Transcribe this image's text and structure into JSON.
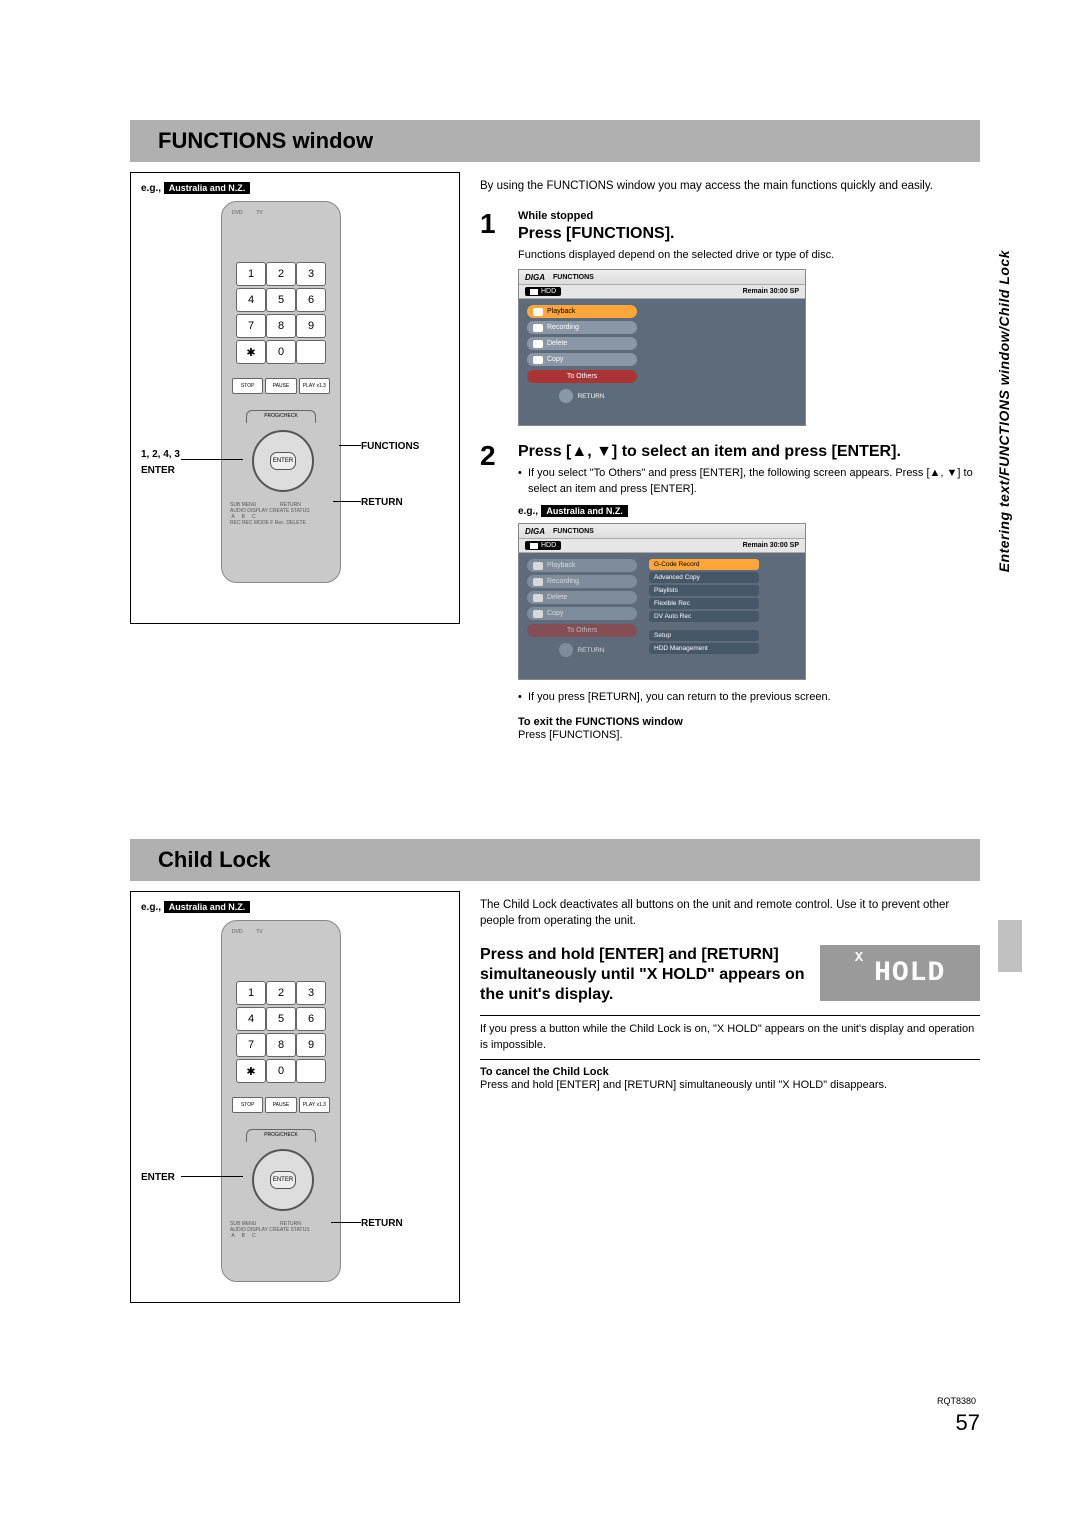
{
  "side_header": "Entering text/FUNCTIONS window/Child Lock",
  "doc_code": "RQT8380",
  "page_number": "57",
  "section1": {
    "title": "FUNCTIONS window",
    "illus": {
      "eg": "e.g.,",
      "region": "Australia and N.Z.",
      "label_functions": "FUNCTIONS",
      "label_return": "RETURN",
      "label_enter": "ENTER",
      "label_steps": "1, 2, 4, 3",
      "keys": [
        "1",
        "2",
        "3",
        "4",
        "5",
        "6",
        "7",
        "8",
        "9",
        "",
        "0",
        ""
      ],
      "enter": "ENTER",
      "btn_stop": "STOP",
      "btn_pause": "PAUSE",
      "btn_play": "PLAY x1.3",
      "prog": "PROG/CHECK",
      "top_dvd": "DVD",
      "top_tv": "TV"
    },
    "intro": "By using the FUNCTIONS window you may access the main functions quickly and easily.",
    "step1": {
      "num": "1",
      "sub": "While stopped",
      "title": "Press [FUNCTIONS].",
      "text": "Functions displayed depend on the selected drive or type of disc."
    },
    "osd1": {
      "logo": "DIGA",
      "func": "FUNCTIONS",
      "hdd": "HDD",
      "remain": "Remain   30:00 SP",
      "rows": [
        {
          "label": "Playback",
          "hi": true
        },
        {
          "label": "Recording",
          "hi": false
        },
        {
          "label": "Delete",
          "hi": false
        },
        {
          "label": "Copy",
          "hi": false
        }
      ],
      "toothers": "To Others",
      "ret": "RETURN"
    },
    "step2": {
      "num": "2",
      "title": "Press [▲, ▼] to select an item and press [ENTER].",
      "bullet1": "If you select \"To Others\" and press [ENTER], the following screen appears. Press [▲, ▼] to select an item and press [ENTER].",
      "eg": "e.g.,",
      "region": "Australia and N.Z."
    },
    "osd2": {
      "logo": "DIGA",
      "func": "FUNCTIONS",
      "hdd": "HDD",
      "remain": "Remain   30:00 SP",
      "left": [
        {
          "label": "Playback"
        },
        {
          "label": "Recording"
        },
        {
          "label": "Delete"
        },
        {
          "label": "Copy"
        }
      ],
      "leftto": "To Others",
      "right": [
        {
          "label": "G-Code Record",
          "hi": true
        },
        {
          "label": "Advanced Copy"
        },
        {
          "label": "Playlists"
        },
        {
          "label": "Flexible Rec"
        },
        {
          "label": "DV Auto Rec"
        },
        {
          "label": "Setup"
        },
        {
          "label": "HDD Management"
        }
      ],
      "ret": "RETURN"
    },
    "after2": "If you press [RETURN], you can return to the previous screen.",
    "exit_title": "To exit the FUNCTIONS window",
    "exit_text": "Press [FUNCTIONS]."
  },
  "section2": {
    "title": "Child Lock",
    "illus": {
      "eg": "e.g.,",
      "region": "Australia and N.Z.",
      "label_enter": "ENTER",
      "label_return": "RETURN",
      "keys": [
        "1",
        "2",
        "3",
        "4",
        "5",
        "6",
        "7",
        "8",
        "9",
        "",
        "0",
        ""
      ],
      "enter": "ENTER"
    },
    "intro": "The Child Lock deactivates all buttons on the unit and remote control. Use it to prevent other people from operating the unit.",
    "xhold_small": "X",
    "xhold_big": "HOLD",
    "main_instr": "Press and hold [ENTER] and [RETURN] simultaneously until \"X HOLD\" appears on the unit's display.",
    "after": "If you press a button while the Child Lock is on, \"X HOLD\" appears on the unit's display and operation is impossible.",
    "cancel_title": "To cancel the Child Lock",
    "cancel_text": "Press and hold [ENTER] and [RETURN] simultaneously until \"X HOLD\" disappears."
  }
}
